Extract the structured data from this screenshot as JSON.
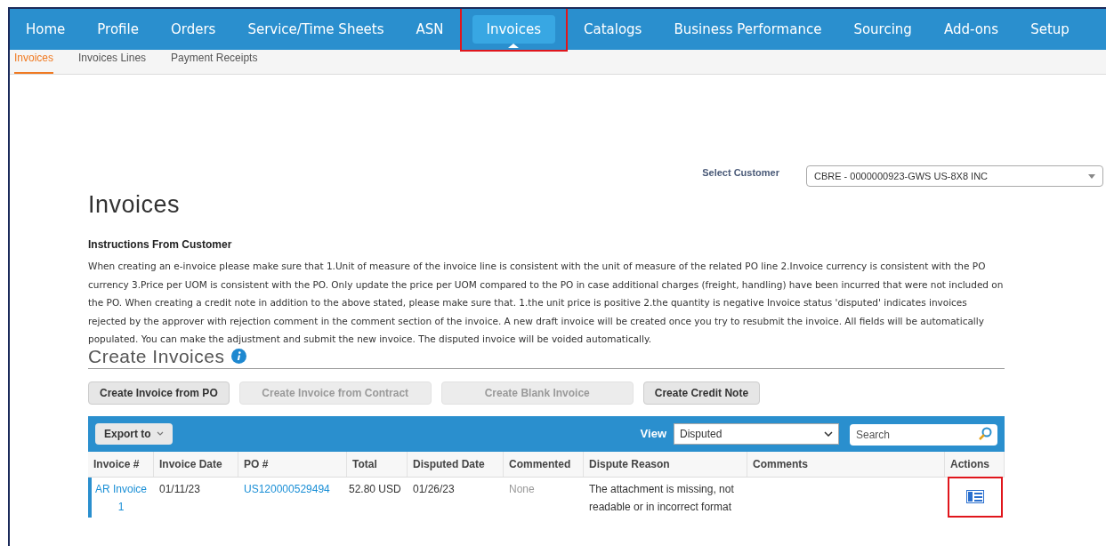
{
  "nav": [
    {
      "label": "Home",
      "selected": false,
      "highlighted": false
    },
    {
      "label": "Profile",
      "selected": false,
      "highlighted": false
    },
    {
      "label": "Orders",
      "selected": false,
      "highlighted": false
    },
    {
      "label": "Service/Time Sheets",
      "selected": false,
      "highlighted": false
    },
    {
      "label": "ASN",
      "selected": false,
      "highlighted": false
    },
    {
      "label": "Invoices",
      "selected": true,
      "highlighted": true
    },
    {
      "label": "Catalogs",
      "selected": false,
      "highlighted": false
    },
    {
      "label": "Business Performance",
      "selected": false,
      "highlighted": false
    },
    {
      "label": "Sourcing",
      "selected": false,
      "highlighted": false
    },
    {
      "label": "Add-ons",
      "selected": false,
      "highlighted": false
    },
    {
      "label": "Setup",
      "selected": false,
      "highlighted": false
    }
  ],
  "subnav": [
    {
      "label": "Invoices",
      "selected": true
    },
    {
      "label": "Invoices Lines",
      "selected": false
    },
    {
      "label": "Payment Receipts",
      "selected": false
    }
  ],
  "customer": {
    "label": "Select Customer",
    "value": "CBRE - 0000000923-GWS US-8X8 INC"
  },
  "title": "Invoices",
  "instructions": {
    "heading": "Instructions From Customer",
    "text": "When creating an e-invoice please make sure that 1.Unit of measure of the invoice line is consistent with the unit of measure of the related PO line 2.Invoice currency is consistent with the PO currency 3.Price per UOM is consistent with the PO. Only update the price per UOM compared to the PO in case additional charges (freight, handling) have been incurred that were not included on the PO. When creating a credit note in addition to the above stated, please make sure that. 1.the unit price is positive 2.the quantity is negative Invoice status 'disputed' indicates invoices rejected by the approver with rejection comment in the comment section of the invoice. A new draft invoice will be created once you try to resubmit the invoice. All fields will be automatically populated. You can make the adjustment and submit the new invoice. The disputed invoice will be voided automatically."
  },
  "create": {
    "title": "Create Invoices",
    "buttons": [
      {
        "label": "Create Invoice from PO",
        "disabled": false
      },
      {
        "label": "Create Invoice from Contract",
        "disabled": true
      },
      {
        "label": "Create Blank Invoice",
        "disabled": true
      },
      {
        "label": "Create Credit Note",
        "disabled": false
      }
    ]
  },
  "toolbar": {
    "export": "Export to",
    "view_label": "View",
    "view": "Disputed",
    "search_placeholder": "Search"
  },
  "table": {
    "columns": [
      "Invoice #",
      "Invoice Date",
      "PO #",
      "Total",
      "Disputed Date",
      "Commented",
      "Dispute Reason",
      "Comments",
      "Actions"
    ],
    "rows": [
      {
        "invoice": "AR Invoice 1",
        "invoice_date": "01/11/23",
        "po": "US120000529494",
        "total": "52.80 USD",
        "disputed_date": "01/26/23",
        "commented": "None",
        "dispute_reason": "The attachment is missing, not readable or in incorrect format",
        "actions_highlighted": true
      }
    ]
  }
}
